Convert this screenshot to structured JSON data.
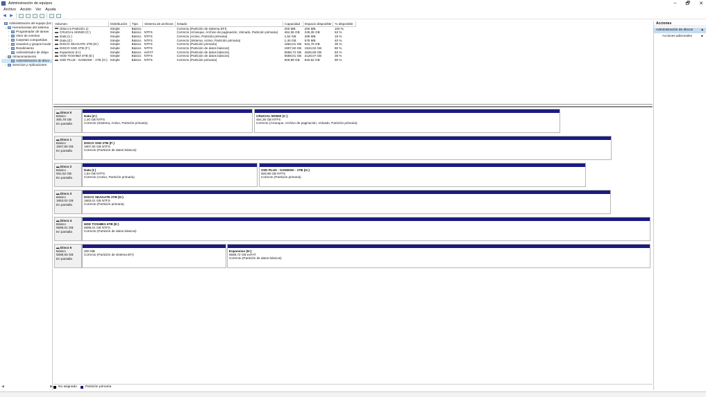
{
  "window": {
    "title": "Administración de equipos",
    "min": "–",
    "max": "🗗",
    "close": "✕"
  },
  "menu": [
    "Archivo",
    "Acción",
    "Ver",
    "Ayuda"
  ],
  "tree": [
    {
      "label": "Administración del equipo (loc",
      "chev": "",
      "indent": 0
    },
    {
      "label": "Herramientas del sistema",
      "chev": "⌄",
      "indent": 1
    },
    {
      "label": "Programador de tareas",
      "chev": "›",
      "indent": 2
    },
    {
      "label": "Visor de eventos",
      "chev": "›",
      "indent": 2
    },
    {
      "label": "Carpetas compartidas",
      "chev": "›",
      "indent": 2
    },
    {
      "label": "Usuarios y grupos locale",
      "chev": "›",
      "indent": 2
    },
    {
      "label": "Rendimiento",
      "chev": "›",
      "indent": 2
    },
    {
      "label": "Administrador de dispo",
      "chev": "",
      "indent": 2
    },
    {
      "label": "Almacenamiento",
      "chev": "⌄",
      "indent": 1
    },
    {
      "label": "Administración de disco",
      "chev": "",
      "indent": 2,
      "selected": true
    },
    {
      "label": "Servicios y Aplicaciones",
      "chev": "›",
      "indent": 1
    }
  ],
  "volumes": {
    "headers": [
      "Volumen",
      "Distribución",
      "Tipo",
      "Sistema de archivos",
      "Estado",
      "Capacidad",
      "Espacio disponible",
      "% disponible"
    ],
    "rows": [
      [
        "(Disco 5 Partición 1)",
        "Simple",
        "Básico",
        "",
        "Correcto (Partición de sistema EFI)",
        "200 MB",
        "200 MB",
        "100 %"
      ],
      [
        "CRUCIAL MX500 (C:)",
        "Simple",
        "Básico",
        "NTFS",
        "Correcto (Arranque, Archivo de paginación, Volcado, Partición primaria)",
        "464,36 GB",
        "248,35 GB",
        "53 %"
      ],
      [
        "Data (1:)",
        "Simple",
        "Básico",
        "NTFS",
        "Correcto (Activo, Partición primaria)",
        "1,54 GB",
        "299 MB",
        "19 %"
      ],
      [
        "Data (Z:)",
        "Simple",
        "Básico",
        "NTFS",
        "Correcto (Sistema, Activo, Partición primaria)",
        "1,40 GB",
        "578 MB",
        "40 %"
      ],
      [
        "DISCO SEAGATE 2TB (D:)",
        "Simple",
        "Básico",
        "NTFS",
        "Correcto (Partición primaria)",
        "1863,01 GB",
        "642,76 GB",
        "35 %"
      ],
      [
        "DISCO SSD 2TB (F:)",
        "Simple",
        "Básico",
        "NTFS",
        "Correcto (Partición de datos básicos)",
        "1907,60 GB",
        "1534,02 GB",
        "80 %"
      ],
      [
        "Expansion (H:)",
        "Simple",
        "Básico",
        "exFAT",
        "Correcto (Partición de datos básicos)",
        "5588,72 GB",
        "4626,69 GB",
        "83 %"
      ],
      [
        "HDD TOSHIBA 6TB (E:)",
        "Simple",
        "Básico",
        "NTFS",
        "Correcto (Partición de datos básicos)",
        "5589,01 GB",
        "2128,07 GB",
        "38 %"
      ],
      [
        "SSD PLUS - SANDISK - 1TB (G:)",
        "Simple",
        "Básico",
        "NTFS",
        "Correcto (Partición primaria)",
        "929,98 GB",
        "840,62 GB",
        "90 %"
      ]
    ]
  },
  "disks": [
    {
      "name": "Disco 0",
      "type": "Básico",
      "size": "465,76 GB",
      "status": "En pantalla",
      "parts": [
        {
          "name": "Data (Z:)",
          "size": "1,40 GB NTFS",
          "state": "Correcto (Sistema, Activo, Partición primaria)"
        },
        {
          "name": "CRUCIAL MX500 (C:)",
          "size": "464,36 GB NTFS",
          "state": "Correcto (Arranque, Archivo de paginación, Volcado, Partición primaria)"
        }
      ]
    },
    {
      "name": "Disco 1",
      "type": "Básico",
      "size": "1907,60 GB",
      "status": "En pantalla",
      "parts": [
        {
          "name": "DISCO SSD 2TB (F:)",
          "size": "1907,60 GB NTFS",
          "state": "Correcto (Partición de datos básicos)"
        }
      ]
    },
    {
      "name": "Disco 2",
      "type": "Básico",
      "size": "931,52 GB",
      "status": "En pantalla",
      "parts": [
        {
          "name": "Data (I:)",
          "size": "1,54 GB NTFS",
          "state": "Correcto (Activo, Partición primaria)"
        },
        {
          "name": "SSD PLUS - SANDISK - 1TB (G:)",
          "size": "929,98 GB NTFS",
          "state": "Correcto (Partición primaria)"
        }
      ]
    },
    {
      "name": "Disco 3",
      "type": "Básico",
      "size": "1863,02 GB",
      "status": "En pantalla",
      "parts": [
        {
          "name": "DISCO SEAGATE 2TB (D:)",
          "size": "1863,01 GB NTFS",
          "state": "Correcto (Partición primaria)"
        }
      ]
    },
    {
      "name": "Disco 4",
      "type": "Básico",
      "size": "5589,01 GB",
      "status": "En pantalla",
      "parts": [
        {
          "name": "HDD TOSHIBA 6TB (E:)",
          "size": "5589,01 GB NTFS",
          "state": "Correcto (Partición de datos básicos)"
        }
      ]
    },
    {
      "name": "Disco 5",
      "type": "Básico",
      "size": "5588,93 GB",
      "status": "En pantalla",
      "parts": [
        {
          "name": "",
          "size": "200 MB",
          "state": "Correcto (Partición de sistema EFI)"
        },
        {
          "name": "Expansion (H:)",
          "size": "5588,72 GB exFAT",
          "state": "Correcto (Partición de datos básicos)"
        }
      ]
    }
  ],
  "legend": [
    {
      "label": "No asignado",
      "color": "#000000"
    },
    {
      "label": "Partición primaria",
      "color": "#1b1b82"
    }
  ],
  "actions": {
    "title": "Acciones",
    "section": "Administración de discos",
    "item": "Acciones adicionales",
    "arrow_up": "▲",
    "arrow_right": "►"
  }
}
